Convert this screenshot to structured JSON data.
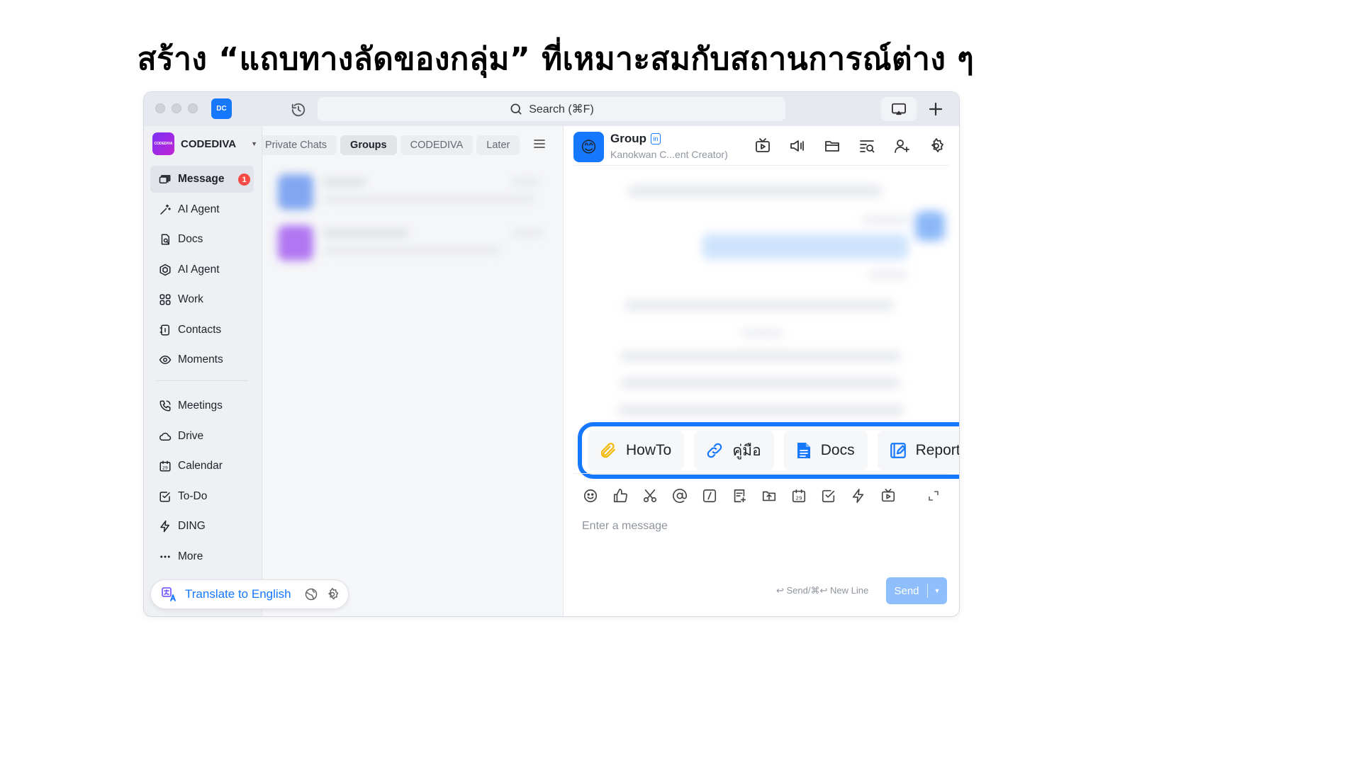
{
  "headline": "สร้าง “แถบทางลัดของกลุ่ม” ที่เหมาะสมกับสถานการณ์ต่าง ๆ",
  "app": {
    "badge": "DC"
  },
  "search": {
    "placeholder": "Search (⌘F)"
  },
  "org": {
    "name": "CODEDIVA",
    "logo_text": "CODEDIVA"
  },
  "sidebar": {
    "items": [
      {
        "label": "Message",
        "icon": "message-icon",
        "badge": "1",
        "active": true
      },
      {
        "label": "AI Agent",
        "icon": "sparkle-icon"
      },
      {
        "label": "Docs",
        "icon": "docs-icon"
      },
      {
        "label": "AI Agent",
        "icon": "hex-agent-icon"
      },
      {
        "label": "Work",
        "icon": "grid-icon"
      },
      {
        "label": "Contacts",
        "icon": "contacts-icon"
      },
      {
        "label": "Moments",
        "icon": "eye-icon"
      }
    ],
    "items2": [
      {
        "label": "Meetings",
        "icon": "phone-icon"
      },
      {
        "label": "Drive",
        "icon": "cloud-icon"
      },
      {
        "label": "Calendar",
        "icon": "calendar-icon"
      },
      {
        "label": "To-Do",
        "icon": "todo-icon"
      },
      {
        "label": "DING",
        "icon": "bolt-icon"
      },
      {
        "label": "More",
        "icon": "more-icon"
      }
    ]
  },
  "translate": {
    "label": "Translate to English"
  },
  "tabs": [
    "Private Chats",
    "Groups",
    "CODEDIVA",
    "Later"
  ],
  "conversation": {
    "title": "Group",
    "tag": "in",
    "subtitle": "Kanokwan C...ent Creator)",
    "avatar_emoji": "😊"
  },
  "quickbar": [
    {
      "label": "HowTo",
      "icon": "paperclip-icon",
      "color": "#f5b800"
    },
    {
      "label": "คู่มือ",
      "icon": "link-icon",
      "color": "#1677ff"
    },
    {
      "label": "Docs",
      "icon": "doc-file-icon",
      "color": "#1677ff"
    },
    {
      "label": "Report",
      "icon": "report-icon",
      "color": "#1677ff"
    }
  ],
  "composer": {
    "placeholder": "Enter a message",
    "hint": "↩ Send/⌘↩ New Line",
    "send_label": "Send"
  },
  "colors": {
    "accent": "#1677ff",
    "badge": "#f54a45"
  }
}
